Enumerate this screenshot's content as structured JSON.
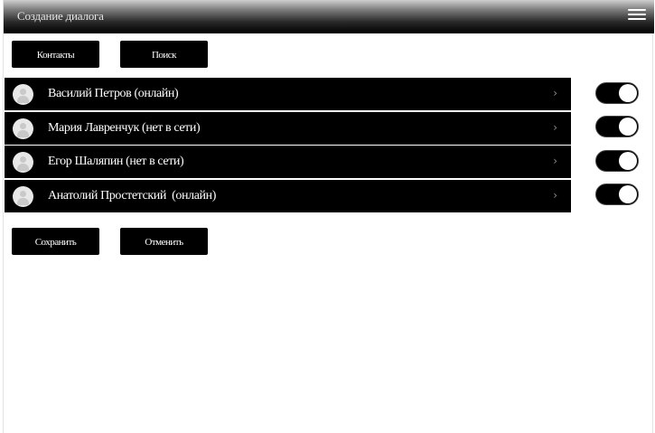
{
  "header": {
    "title": "Создание диалога",
    "menu_icon": "hamburger-menu-icon"
  },
  "top_buttons": {
    "contacts_label": "Контакты",
    "search_label": "Поиск"
  },
  "contacts": [
    {
      "name": "Василий Петров (онлайн)",
      "checked": true
    },
    {
      "name": "Мария Лавренчук (нет в сети)",
      "checked": true
    },
    {
      "name": "Егор Шаляпин (нет в сети)",
      "checked": true
    },
    {
      "name": "Анатолий Простетский  (онлайн)",
      "checked": true
    }
  ],
  "row_chevron": "›",
  "bottom_buttons": {
    "save_label": "Сохранить",
    "cancel_label": "Отменить"
  },
  "colors": {
    "button_bg": "#000000",
    "row_bg": "#000000",
    "toggle_on_bg": "#000000",
    "toggle_knob": "#ffffff"
  }
}
